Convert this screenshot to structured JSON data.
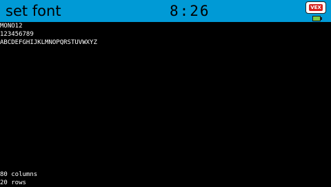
{
  "header": {
    "title": "set font",
    "clock": "8:26",
    "logo_text": "VEX",
    "header_color": "#009ad6",
    "battery_color": "#7ac943",
    "logo_icon": "vex-logo-icon",
    "battery_icon": "battery-icon"
  },
  "console": {
    "lines": [
      "MONO12",
      "123456789",
      "ABCDEFGHIJKLMNOPQRSTUVWXYZ"
    ],
    "footer": [
      "80 columns",
      "20 rows"
    ]
  }
}
